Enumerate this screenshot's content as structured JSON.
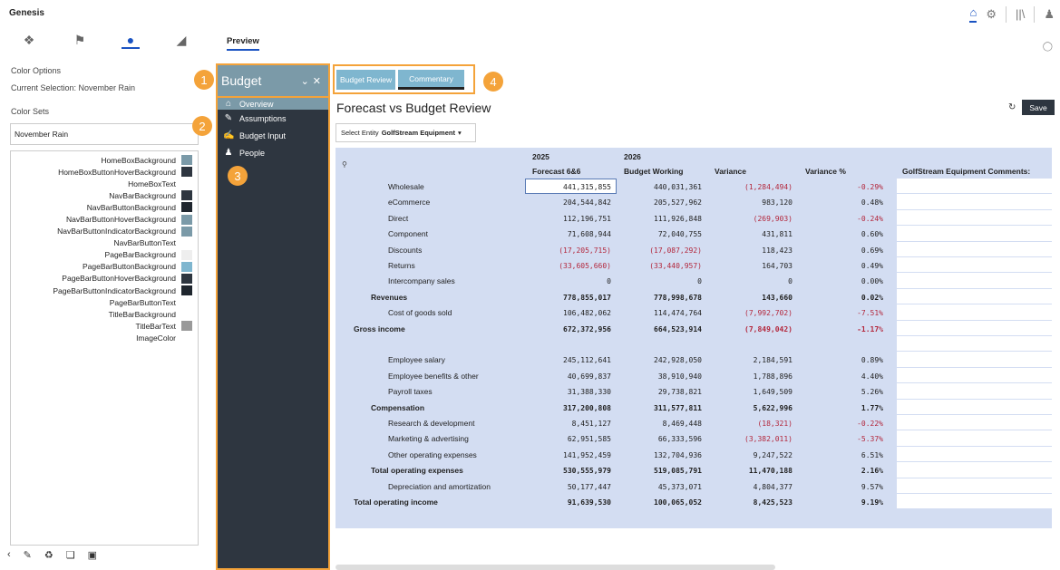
{
  "app": {
    "title": "Genesis"
  },
  "topbar": {
    "icons": [
      "home-icon",
      "gear-icon",
      "library-icon",
      "user-icon"
    ]
  },
  "tools": {
    "icons": [
      "compass-icon",
      "map-icon",
      "palette-icon",
      "layers-icon"
    ],
    "preview_tab": "Preview"
  },
  "left": {
    "color_options": "Color Options",
    "current_selection": "Current Selection:  November Rain",
    "color_sets": "Color Sets",
    "color_set_value": "November Rain",
    "colors": [
      {
        "name": "HomeBoxBackground",
        "swatch": "#7b9aa8"
      },
      {
        "name": "HomeBoxButtonHoverBackground",
        "swatch": "#2e3640"
      },
      {
        "name": "HomeBoxText",
        "swatch": "#ffffff"
      },
      {
        "name": "NavBarBackground",
        "swatch": "#2e3640"
      },
      {
        "name": "NavBarButtonBackground",
        "swatch": "#1f262e"
      },
      {
        "name": "NavBarButtonHoverBackground",
        "swatch": "#7b9aa8"
      },
      {
        "name": "NavBarButtonIndicatorBackground",
        "swatch": "#7b9aa8"
      },
      {
        "name": "NavBarButtonText",
        "swatch": "#ffffff"
      },
      {
        "name": "PageBarBackground",
        "swatch": "#eeeeee"
      },
      {
        "name": "PageBarButtonBackground",
        "swatch": "#7fb6cf"
      },
      {
        "name": "PageBarButtonHoverBackground",
        "swatch": "#2e3640"
      },
      {
        "name": "PageBarButtonIndicatorBackground",
        "swatch": "#1f262e"
      },
      {
        "name": "PageBarButtonText",
        "swatch": "#ffffff"
      },
      {
        "name": "TitleBarBackground",
        "swatch": "#ffffff"
      },
      {
        "name": "TitleBarText",
        "swatch": "#999999"
      },
      {
        "name": "ImageColor",
        "swatch": "#ffffff"
      }
    ]
  },
  "nav": {
    "title": "Budget",
    "items": [
      {
        "label": "Overview",
        "icon": "home-icon"
      },
      {
        "label": "Assumptions",
        "icon": "pencil-icon"
      },
      {
        "label": "Budget Input",
        "icon": "edit-icon"
      },
      {
        "label": "People",
        "icon": "people-icon"
      }
    ]
  },
  "badges": [
    "1",
    "2",
    "3",
    "4"
  ],
  "tabs": [
    "Budget Review",
    "Commentary"
  ],
  "main": {
    "title": "Forecast vs Budget Review",
    "save": "Save",
    "entity_label": "Select Entity",
    "entity_value": "GolfStream Equipment",
    "year1": "2025",
    "year2": "2026",
    "col_headers": [
      "Forecast 6&6",
      "Budget Working",
      "Variance",
      "Variance %",
      "GolfStream Equipment Comments:"
    ],
    "rows": [
      {
        "label": "Wholesale",
        "indent": 2,
        "v": [
          "441,315,855",
          "440,031,361",
          "(1,284,494)",
          "-0.29%"
        ]
      },
      {
        "label": "eCommerce",
        "indent": 2,
        "v": [
          "204,544,842",
          "205,527,962",
          "983,120",
          "0.48%"
        ]
      },
      {
        "label": "Direct",
        "indent": 2,
        "v": [
          "112,196,751",
          "111,926,848",
          "(269,903)",
          "-0.24%"
        ]
      },
      {
        "label": "Component",
        "indent": 2,
        "v": [
          "71,608,944",
          "72,040,755",
          "431,811",
          "0.60%"
        ]
      },
      {
        "label": "Discounts",
        "indent": 2,
        "v": [
          "(17,205,715)",
          "(17,087,292)",
          "118,423",
          "0.69%"
        ]
      },
      {
        "label": "Returns",
        "indent": 2,
        "v": [
          "(33,605,660)",
          "(33,440,957)",
          "164,703",
          "0.49%"
        ]
      },
      {
        "label": "Intercompany sales",
        "indent": 2,
        "v": [
          "0",
          "0",
          "0",
          "0.00%"
        ]
      },
      {
        "label": "Revenues",
        "indent": 1,
        "bold": true,
        "v": [
          "778,855,017",
          "778,998,678",
          "143,660",
          "0.02%"
        ]
      },
      {
        "label": "Cost of goods sold",
        "indent": 2,
        "v": [
          "106,482,062",
          "114,474,764",
          "(7,992,702)",
          "-7.51%"
        ]
      },
      {
        "label": "Gross income",
        "indent": 0,
        "bold": true,
        "v": [
          "672,372,956",
          "664,523,914",
          "(7,849,042)",
          "-1.17%"
        ]
      },
      {
        "label": "",
        "indent": 0,
        "v": [
          "",
          "",
          "",
          ""
        ]
      },
      {
        "label": "Employee salary",
        "indent": 2,
        "v": [
          "245,112,641",
          "242,928,050",
          "2,184,591",
          "0.89%"
        ]
      },
      {
        "label": "Employee benefits & other",
        "indent": 2,
        "v": [
          "40,699,837",
          "38,910,940",
          "1,788,896",
          "4.40%"
        ]
      },
      {
        "label": "Payroll taxes",
        "indent": 2,
        "v": [
          "31,388,330",
          "29,738,821",
          "1,649,509",
          "5.26%"
        ]
      },
      {
        "label": "Compensation",
        "indent": 1,
        "bold": true,
        "v": [
          "317,200,808",
          "311,577,811",
          "5,622,996",
          "1.77%"
        ]
      },
      {
        "label": "Research & development",
        "indent": 2,
        "v": [
          "8,451,127",
          "8,469,448",
          "(18,321)",
          "-0.22%"
        ]
      },
      {
        "label": "Marketing & advertising",
        "indent": 2,
        "v": [
          "62,951,585",
          "66,333,596",
          "(3,382,011)",
          "-5.37%"
        ]
      },
      {
        "label": "Other operating expenses",
        "indent": 2,
        "v": [
          "141,952,459",
          "132,704,936",
          "9,247,522",
          "6.51%"
        ]
      },
      {
        "label": "Total operating expenses",
        "indent": 1,
        "bold": true,
        "v": [
          "530,555,979",
          "519,085,791",
          "11,470,188",
          "2.16%"
        ]
      },
      {
        "label": "Depreciation and amortization",
        "indent": 2,
        "v": [
          "50,177,447",
          "45,373,071",
          "4,804,377",
          "9.57%"
        ]
      },
      {
        "label": "Total operating income",
        "indent": 0,
        "bold": true,
        "v": [
          "91,639,530",
          "100,065,052",
          "8,425,523",
          "9.19%"
        ]
      }
    ]
  }
}
